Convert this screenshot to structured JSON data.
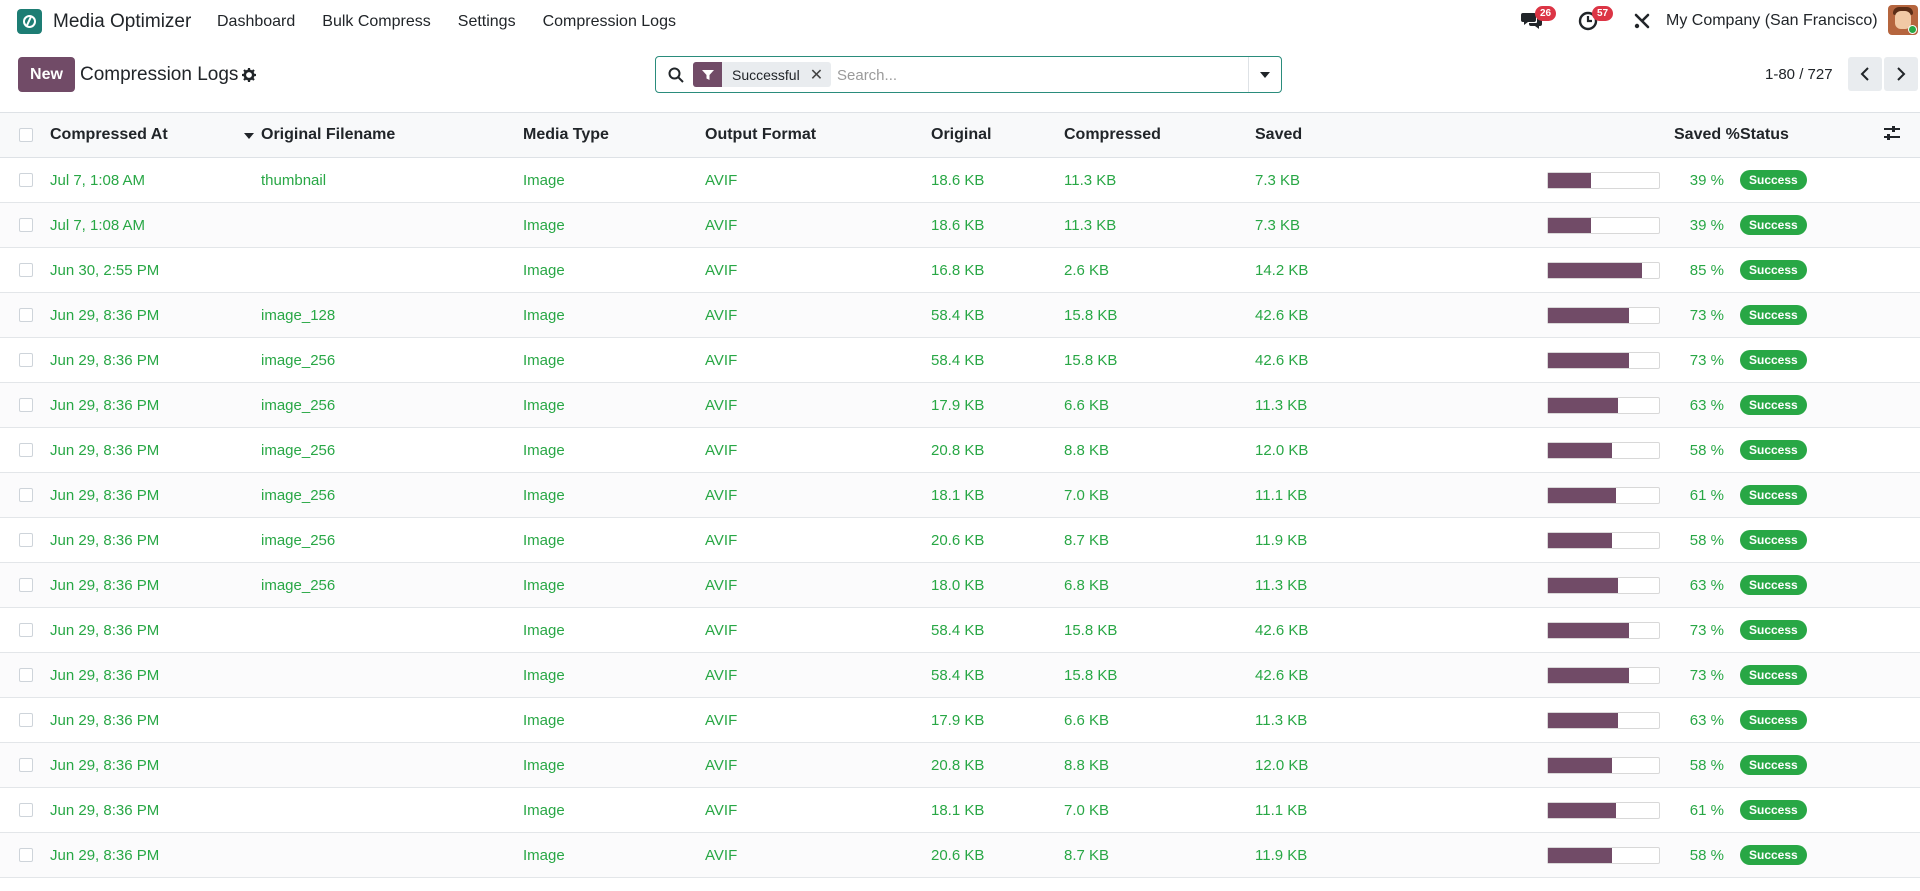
{
  "app": {
    "name": "Media Optimizer"
  },
  "nav": {
    "items": [
      "Dashboard",
      "Bulk Compress",
      "Settings",
      "Compression Logs"
    ]
  },
  "systray": {
    "messages_count": "26",
    "activities_count": "57",
    "company": "My Company (San Francisco)"
  },
  "control": {
    "new_label": "New",
    "title": "Compression Logs",
    "facet_label": "Successful",
    "search_placeholder": "Search...",
    "pager": "1-80 / 727"
  },
  "columns": {
    "compressed_at": "Compressed At",
    "filename": "Original Filename",
    "media_type": "Media Type",
    "output_format": "Output Format",
    "original": "Original",
    "compressed": "Compressed",
    "saved": "Saved",
    "saved_pct": "Saved %",
    "status": "Status"
  },
  "rows": [
    {
      "date": "Jul 7, 1:08 AM",
      "filename": "thumbnail",
      "type": "Image",
      "format": "AVIF",
      "original": "18.6 KB",
      "compressed": "11.3 KB",
      "saved": "7.3 KB",
      "pct_value": 39,
      "pct": "39 %",
      "status": "Success"
    },
    {
      "date": "Jul 7, 1:08 AM",
      "filename": "",
      "type": "Image",
      "format": "AVIF",
      "original": "18.6 KB",
      "compressed": "11.3 KB",
      "saved": "7.3 KB",
      "pct_value": 39,
      "pct": "39 %",
      "status": "Success"
    },
    {
      "date": "Jun 30, 2:55 PM",
      "filename": "",
      "type": "Image",
      "format": "AVIF",
      "original": "16.8 KB",
      "compressed": "2.6 KB",
      "saved": "14.2 KB",
      "pct_value": 85,
      "pct": "85 %",
      "status": "Success"
    },
    {
      "date": "Jun 29, 8:36 PM",
      "filename": "image_128",
      "type": "Image",
      "format": "AVIF",
      "original": "58.4 KB",
      "compressed": "15.8 KB",
      "saved": "42.6 KB",
      "pct_value": 73,
      "pct": "73 %",
      "status": "Success"
    },
    {
      "date": "Jun 29, 8:36 PM",
      "filename": "image_256",
      "type": "Image",
      "format": "AVIF",
      "original": "58.4 KB",
      "compressed": "15.8 KB",
      "saved": "42.6 KB",
      "pct_value": 73,
      "pct": "73 %",
      "status": "Success"
    },
    {
      "date": "Jun 29, 8:36 PM",
      "filename": "image_256",
      "type": "Image",
      "format": "AVIF",
      "original": "17.9 KB",
      "compressed": "6.6 KB",
      "saved": "11.3 KB",
      "pct_value": 63,
      "pct": "63 %",
      "status": "Success"
    },
    {
      "date": "Jun 29, 8:36 PM",
      "filename": "image_256",
      "type": "Image",
      "format": "AVIF",
      "original": "20.8 KB",
      "compressed": "8.8 KB",
      "saved": "12.0 KB",
      "pct_value": 58,
      "pct": "58 %",
      "status": "Success"
    },
    {
      "date": "Jun 29, 8:36 PM",
      "filename": "image_256",
      "type": "Image",
      "format": "AVIF",
      "original": "18.1 KB",
      "compressed": "7.0 KB",
      "saved": "11.1 KB",
      "pct_value": 61,
      "pct": "61 %",
      "status": "Success"
    },
    {
      "date": "Jun 29, 8:36 PM",
      "filename": "image_256",
      "type": "Image",
      "format": "AVIF",
      "original": "20.6 KB",
      "compressed": "8.7 KB",
      "saved": "11.9 KB",
      "pct_value": 58,
      "pct": "58 %",
      "status": "Success"
    },
    {
      "date": "Jun 29, 8:36 PM",
      "filename": "image_256",
      "type": "Image",
      "format": "AVIF",
      "original": "18.0 KB",
      "compressed": "6.8 KB",
      "saved": "11.3 KB",
      "pct_value": 63,
      "pct": "63 %",
      "status": "Success"
    },
    {
      "date": "Jun 29, 8:36 PM",
      "filename": "",
      "type": "Image",
      "format": "AVIF",
      "original": "58.4 KB",
      "compressed": "15.8 KB",
      "saved": "42.6 KB",
      "pct_value": 73,
      "pct": "73 %",
      "status": "Success"
    },
    {
      "date": "Jun 29, 8:36 PM",
      "filename": "",
      "type": "Image",
      "format": "AVIF",
      "original": "58.4 KB",
      "compressed": "15.8 KB",
      "saved": "42.6 KB",
      "pct_value": 73,
      "pct": "73 %",
      "status": "Success"
    },
    {
      "date": "Jun 29, 8:36 PM",
      "filename": "",
      "type": "Image",
      "format": "AVIF",
      "original": "17.9 KB",
      "compressed": "6.6 KB",
      "saved": "11.3 KB",
      "pct_value": 63,
      "pct": "63 %",
      "status": "Success"
    },
    {
      "date": "Jun 29, 8:36 PM",
      "filename": "",
      "type": "Image",
      "format": "AVIF",
      "original": "20.8 KB",
      "compressed": "8.8 KB",
      "saved": "12.0 KB",
      "pct_value": 58,
      "pct": "58 %",
      "status": "Success"
    },
    {
      "date": "Jun 29, 8:36 PM",
      "filename": "",
      "type": "Image",
      "format": "AVIF",
      "original": "18.1 KB",
      "compressed": "7.0 KB",
      "saved": "11.1 KB",
      "pct_value": 61,
      "pct": "61 %",
      "status": "Success"
    },
    {
      "date": "Jun 29, 8:36 PM",
      "filename": "",
      "type": "Image",
      "format": "AVIF",
      "original": "20.6 KB",
      "compressed": "8.7 KB",
      "saved": "11.9 KB",
      "pct_value": 58,
      "pct": "58 %",
      "status": "Success"
    }
  ],
  "colors": {
    "brand": "#714b67",
    "app_icon": "#1d7d74",
    "success": "#28a745",
    "badge_red": "#dc3545"
  },
  "icons": {
    "app_logo": "app-logo-icon",
    "messages": "chat-bubbles-icon",
    "activities": "clock-icon",
    "debug": "tools-icon",
    "settings": "gear-icon",
    "search": "search-icon",
    "filter": "filter-icon",
    "optional_columns": "sliders-icon"
  }
}
